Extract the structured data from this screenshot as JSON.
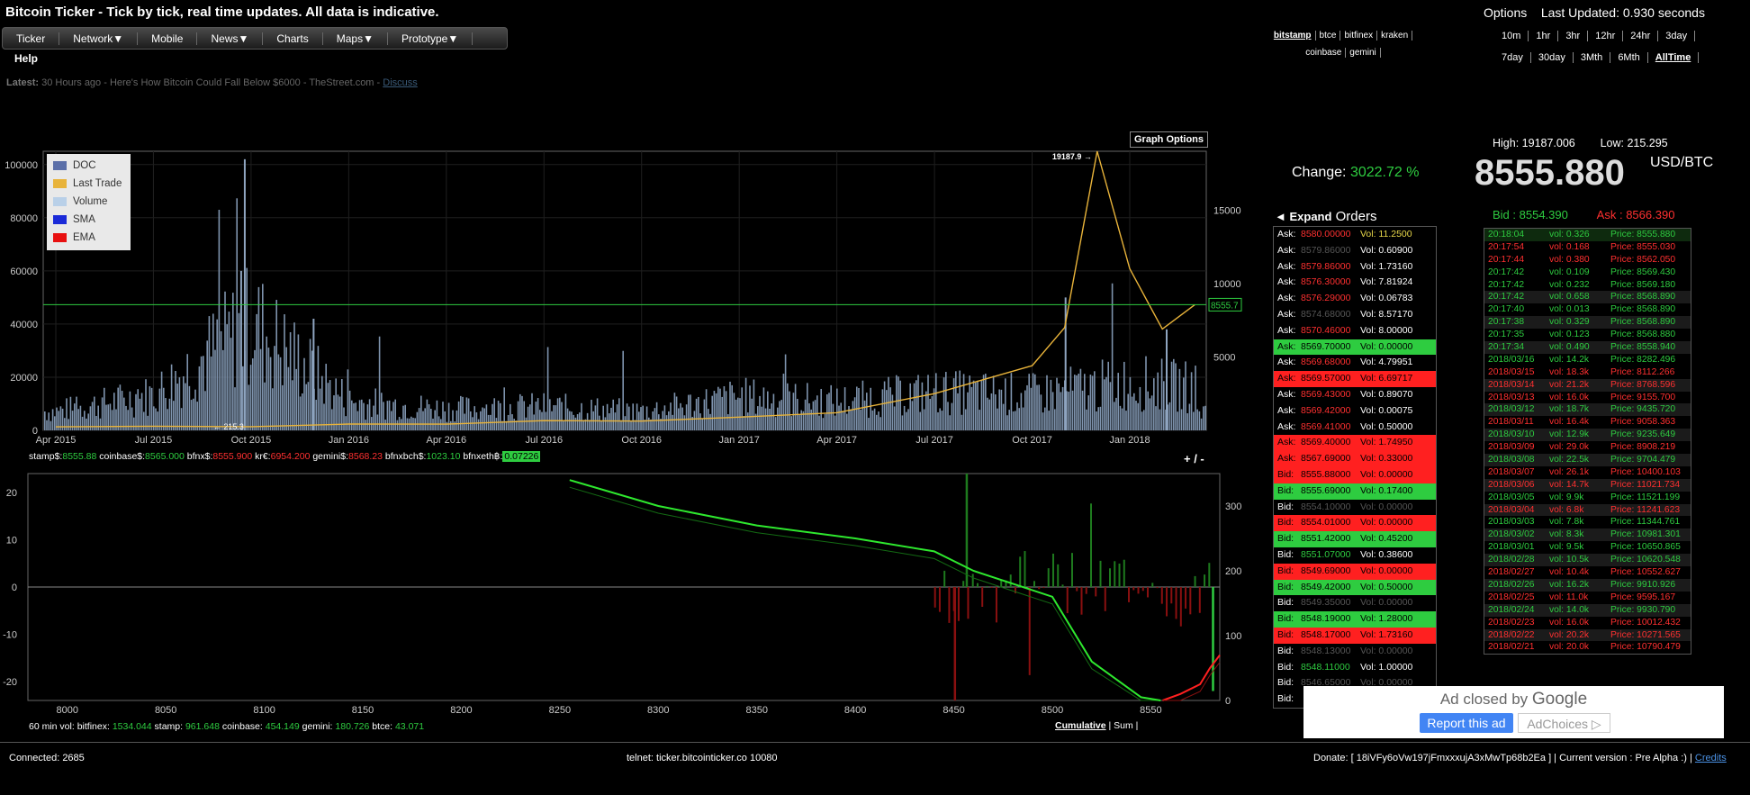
{
  "site": {
    "title": "Bitcoin Ticker - Tick by tick, real time updates. All data is indicative.",
    "nav": [
      "Ticker",
      "Network▼",
      "Mobile",
      "News▼",
      "Charts",
      "Maps▼",
      "Prototype▼"
    ],
    "help": "Help",
    "latest_label": "Latest:",
    "latest_text": "30 Hours ago - Here's How Bitcoin Could Fall Below $6000 - TheStreet.com -",
    "latest_link": "Discuss"
  },
  "exchanges": [
    "bitstamp",
    "btce",
    "bitfinex",
    "kraken",
    "coinbase",
    "gemini"
  ],
  "options": {
    "label": "Options",
    "updated_label": "Last Updated:",
    "updated_value": "0.930",
    "updated_unit": "seconds"
  },
  "ranges_row1": [
    "10m",
    "1hr",
    "3hr",
    "12hr",
    "24hr",
    "3day"
  ],
  "ranges_row2": [
    "7day",
    "30day",
    "3Mth",
    "6Mth",
    "AllTime"
  ],
  "graph_options": "Graph Options",
  "legend": [
    {
      "name": "DOC",
      "color": "#5b6fa8"
    },
    {
      "name": "Last Trade",
      "color": "#e8b33a"
    },
    {
      "name": "Volume",
      "color": "#b9d0e8"
    },
    {
      "name": "SMA",
      "color": "#1a2ad8"
    },
    {
      "name": "EMA",
      "color": "#e81010"
    }
  ],
  "chart_data": [
    {
      "type": "line",
      "x_ticks": [
        "Apr 2015",
        "Jul 2015",
        "Oct 2015",
        "Jan 2016",
        "Apr 2016",
        "Jul 2016",
        "Oct 2016",
        "Jan 2017",
        "Apr 2017",
        "Jul 2017",
        "Oct 2017",
        "Jan 2018"
      ],
      "y_left_ticks": [
        "0",
        "20000",
        "40000",
        "60000",
        "80000",
        "100000"
      ],
      "y_right_ticks": [
        "5000",
        "10000",
        "15000"
      ],
      "ylim_left": [
        0,
        105000
      ],
      "ylim_right": [
        0,
        19000
      ],
      "price_marks": {
        "high": "19187.9",
        "low": "215.3",
        "current": "8555.7"
      },
      "series": [
        {
          "name": "Last Trade",
          "x": [
            "Apr 2015",
            "Jul 2015",
            "Oct 2015",
            "Jan 2016",
            "Apr 2016",
            "Jul 2016",
            "Oct 2016",
            "Jan 2017",
            "Apr 2017",
            "Jul 2017",
            "Oct 2017",
            "Nov 2017",
            "Dec 2017",
            "Jan 2018",
            "Feb 2018",
            "Mar 2018"
          ],
          "values": [
            240,
            280,
            250,
            430,
            420,
            660,
            630,
            900,
            1200,
            2500,
            4400,
            7000,
            19000,
            11000,
            6900,
            8555
          ]
        },
        {
          "name": "Volume",
          "x": [
            "Apr 2015",
            "Jul 2015",
            "Oct 2015",
            "Jan 2016",
            "Apr 2016",
            "Jul 2016",
            "Oct 2016",
            "Jan 2017",
            "Apr 2017",
            "Jul 2017",
            "Oct 2017",
            "Jan 2018",
            "Mar 2018"
          ],
          "values": [
            8000,
            15000,
            45000,
            12000,
            9000,
            10000,
            8000,
            14000,
            12000,
            16000,
            15000,
            20000,
            18000
          ]
        }
      ],
      "grid": true,
      "legend_position": "top-left"
    },
    {
      "type": "area",
      "x_ticks": [
        "8000",
        "8050",
        "8100",
        "8150",
        "8200",
        "8250",
        "8300",
        "8350",
        "8400",
        "8450",
        "8500",
        "8550"
      ],
      "y_left_ticks": [
        "-20",
        "-10",
        "0",
        "10",
        "20"
      ],
      "y_right_ticks": [
        "0",
        "100",
        "200",
        "300"
      ],
      "xlim": [
        7980,
        8585
      ],
      "ylim_left": [
        -24,
        24
      ],
      "ylim_right": [
        0,
        350
      ],
      "series": [
        {
          "name": "Bid cumulative",
          "x": [
            8255,
            8300,
            8350,
            8400,
            8440,
            8460,
            8500,
            8520,
            8545,
            8555
          ],
          "values": [
            340,
            300,
            270,
            250,
            230,
            200,
            160,
            60,
            5,
            0
          ]
        },
        {
          "name": "Ask cumulative",
          "x": [
            8556,
            8565,
            8575,
            8580,
            8585
          ],
          "values": [
            0,
            10,
            25,
            50,
            70
          ]
        }
      ]
    }
  ],
  "mid_prices": [
    {
      "label": "stamp$:",
      "value": "8555.88",
      "cls": "g"
    },
    {
      "label": "coinbase$:",
      "value": "8565.000",
      "cls": "g"
    },
    {
      "label": "bfnx$:",
      "value": "8555.900",
      "cls": "r"
    },
    {
      "label": "kr€:",
      "value": "6954.200",
      "cls": "r"
    },
    {
      "label": "gemini$:",
      "value": "8568.23",
      "cls": "r"
    },
    {
      "label": "bfnxbch$:",
      "value": "1023.10",
      "cls": "g"
    },
    {
      "label": "bfnxeth฿:",
      "value": "0.07226",
      "cls": "box"
    }
  ],
  "plusminus": "+ / -",
  "vol60": {
    "label": "60 min vol:",
    "items": [
      {
        "label": "bitfinex:",
        "value": "1534.044"
      },
      {
        "label": "stamp:",
        "value": "961.648"
      },
      {
        "label": "coinbase:",
        "value": "454.149"
      },
      {
        "label": "gemini:",
        "value": "180.726"
      },
      {
        "label": "btce:",
        "value": "43.071"
      }
    ]
  },
  "cum_toggle": {
    "cumulative": "Cumulative",
    "sum": "Sum"
  },
  "footer": {
    "connected": "Connected:  2685",
    "telnet": "telnet: ticker.bitcointicker.co 10080",
    "donate": "Donate: [ 18iVFy6oVw197jFmxxxujA3xMwTp68b2Ea ] | Current version : Pre Alpha :) |",
    "credits": "Credits"
  },
  "stats": {
    "high_label": "High:",
    "high": "19187.006",
    "low_label": "Low:",
    "low": "215.295",
    "price": "8555.880",
    "unit": "USD/BTC",
    "change_label": "Change:",
    "change": "3022.72 %",
    "bid_label": "Bid  :",
    "bid": "8554.390",
    "ask_label": "Ask  :",
    "ask": "8566.390"
  },
  "orders_header": {
    "expand": "◄ Expand",
    "title": "Orders"
  },
  "orderbook": [
    {
      "side": "Ask:",
      "price": "8580.00000",
      "vol": "Vol: 11.2500",
      "pc": "#ff3030",
      "vc": "#e8d84a",
      "bg": ""
    },
    {
      "side": "Ask:",
      "price": "8579.86000",
      "vol": "Vol: 0.60900",
      "pc": "#555",
      "vc": "#fff",
      "bg": ""
    },
    {
      "side": "Ask:",
      "price": "8579.86000",
      "vol": "Vol: 1.73160",
      "pc": "#ff3030",
      "vc": "#fff",
      "bg": ""
    },
    {
      "side": "Ask:",
      "price": "8576.30000",
      "vol": "Vol: 7.81924",
      "pc": "#ff3030",
      "vc": "#fff",
      "bg": ""
    },
    {
      "side": "Ask:",
      "price": "8576.29000",
      "vol": "Vol: 0.06783",
      "pc": "#ff3030",
      "vc": "#fff",
      "bg": ""
    },
    {
      "side": "Ask:",
      "price": "8574.68000",
      "vol": "Vol: 8.57170",
      "pc": "#555",
      "vc": "#fff",
      "bg": ""
    },
    {
      "side": "Ask:",
      "price": "8570.46000",
      "vol": "Vol: 8.00000",
      "pc": "#ff3030",
      "vc": "#fff",
      "bg": ""
    },
    {
      "side": "Ask:",
      "price": "8569.70000",
      "vol": "Vol: 0.00000",
      "pc": "#000",
      "vc": "#000",
      "bg": "#2ecc40"
    },
    {
      "side": "Ask:",
      "price": "8569.68000",
      "vol": "Vol: 4.79951",
      "pc": "#ff3030",
      "vc": "#fff",
      "bg": ""
    },
    {
      "side": "Ask:",
      "price": "8569.57000",
      "vol": "Vol: 6.69717",
      "pc": "#000",
      "vc": "#000",
      "bg": "#ff2020"
    },
    {
      "side": "Ask:",
      "price": "8569.43000",
      "vol": "Vol: 0.89070",
      "pc": "#ff3030",
      "vc": "#fff",
      "bg": ""
    },
    {
      "side": "Ask:",
      "price": "8569.42000",
      "vol": "Vol: 0.00075",
      "pc": "#ff3030",
      "vc": "#fff",
      "bg": ""
    },
    {
      "side": "Ask:",
      "price": "8569.41000",
      "vol": "Vol: 0.50000",
      "pc": "#ff3030",
      "vc": "#fff",
      "bg": ""
    },
    {
      "side": "Ask:",
      "price": "8569.40000",
      "vol": "Vol: 1.74950",
      "pc": "#000",
      "vc": "#000",
      "bg": "#ff2020"
    },
    {
      "side": "Ask:",
      "price": "8567.69000",
      "vol": "Vol: 0.33000",
      "pc": "#000",
      "vc": "#000",
      "bg": "#ff2020"
    },
    {
      "side": "Bid:",
      "price": "8555.88000",
      "vol": "Vol: 0.00000",
      "pc": "#000",
      "vc": "#000",
      "bg": "#ff2020"
    },
    {
      "side": "Bid:",
      "price": "8555.69000",
      "vol": "Vol: 0.17400",
      "pc": "#000",
      "vc": "#000",
      "bg": "#2ecc40"
    },
    {
      "side": "Bid:",
      "price": "8554.10000",
      "vol": "Vol: 0.00000",
      "pc": "#555",
      "vc": "#555",
      "bg": ""
    },
    {
      "side": "Bid:",
      "price": "8554.01000",
      "vol": "Vol: 0.00000",
      "pc": "#000",
      "vc": "#000",
      "bg": "#ff2020"
    },
    {
      "side": "Bid:",
      "price": "8551.42000",
      "vol": "Vol: 0.45200",
      "pc": "#000",
      "vc": "#000",
      "bg": "#2ecc40"
    },
    {
      "side": "Bid:",
      "price": "8551.07000",
      "vol": "Vol: 0.38600",
      "pc": "#2ecc40",
      "vc": "#fff",
      "bg": ""
    },
    {
      "side": "Bid:",
      "price": "8549.69000",
      "vol": "Vol: 0.00000",
      "pc": "#000",
      "vc": "#000",
      "bg": "#ff2020"
    },
    {
      "side": "Bid:",
      "price": "8549.42000",
      "vol": "Vol: 0.50000",
      "pc": "#000",
      "vc": "#000",
      "bg": "#2ecc40"
    },
    {
      "side": "Bid:",
      "price": "8549.35000",
      "vol": "Vol: 0.00000",
      "pc": "#555",
      "vc": "#555",
      "bg": ""
    },
    {
      "side": "Bid:",
      "price": "8548.19000",
      "vol": "Vol: 1.28000",
      "pc": "#000",
      "vc": "#000",
      "bg": "#2ecc40"
    },
    {
      "side": "Bid:",
      "price": "8548.17000",
      "vol": "Vol: 1.73160",
      "pc": "#000",
      "vc": "#000",
      "bg": "#ff2020"
    },
    {
      "side": "Bid:",
      "price": "8548.13000",
      "vol": "Vol: 0.00000",
      "pc": "#555",
      "vc": "#555",
      "bg": ""
    },
    {
      "side": "Bid:",
      "price": "8548.11000",
      "vol": "Vol: 1.00000",
      "pc": "#2ecc40",
      "vc": "#fff",
      "bg": ""
    },
    {
      "side": "Bid:",
      "price": "8546.65000",
      "vol": "Vol: 0.00000",
      "pc": "#555",
      "vc": "#555",
      "bg": ""
    },
    {
      "side": "Bid:",
      "price": "",
      "vol": "",
      "pc": "#fff",
      "vc": "#fff",
      "bg": ""
    }
  ],
  "trades": [
    {
      "t": "20:18:04",
      "v": "vol: 0.326",
      "p": "Price: 8555.880",
      "c": "#2ecc40",
      "bg": "#0e2a0e"
    },
    {
      "t": "20:17:54",
      "v": "vol: 0.168",
      "p": "Price: 8555.030",
      "c": "#ff3030",
      "bg": ""
    },
    {
      "t": "20:17:44",
      "v": "vol: 0.380",
      "p": "Price: 8562.050",
      "c": "#ff3030",
      "bg": ""
    },
    {
      "t": "20:17:42",
      "v": "vol: 0.109",
      "p": "Price: 8569.430",
      "c": "#2ecc40",
      "bg": ""
    },
    {
      "t": "20:17:42",
      "v": "vol: 0.232",
      "p": "Price: 8569.180",
      "c": "#2ecc40",
      "bg": ""
    },
    {
      "t": "20:17:42",
      "v": "vol: 0.658",
      "p": "Price: 8568.890",
      "c": "#2ecc40",
      "bg": "#1b1b1b"
    },
    {
      "t": "20:17:40",
      "v": "vol: 0.013",
      "p": "Price: 8568.890",
      "c": "#2ecc40",
      "bg": ""
    },
    {
      "t": "20:17:38",
      "v": "vol: 0.329",
      "p": "Price: 8568.890",
      "c": "#2ecc40",
      "bg": "#1b1b1b"
    },
    {
      "t": "20:17:35",
      "v": "vol: 0.123",
      "p": "Price: 8568.880",
      "c": "#2ecc40",
      "bg": ""
    },
    {
      "t": "20:17:34",
      "v": "vol: 0.490",
      "p": "Price: 8558.940",
      "c": "#2ecc40",
      "bg": "#1b1b1b"
    },
    {
      "t": "2018/03/16",
      "v": "vol: 14.2k",
      "p": "Price: 8282.496",
      "c": "#2ecc40",
      "bg": ""
    },
    {
      "t": "2018/03/15",
      "v": "vol: 18.3k",
      "p": "Price: 8112.266",
      "c": "#ff3030",
      "bg": ""
    },
    {
      "t": "2018/03/14",
      "v": "vol: 21.2k",
      "p": "Price: 8768.596",
      "c": "#ff3030",
      "bg": "#1b1b1b"
    },
    {
      "t": "2018/03/13",
      "v": "vol: 16.0k",
      "p": "Price: 9155.700",
      "c": "#ff3030",
      "bg": ""
    },
    {
      "t": "2018/03/12",
      "v": "vol: 18.7k",
      "p": "Price: 9435.720",
      "c": "#2ecc40",
      "bg": "#1b1b1b"
    },
    {
      "t": "2018/03/11",
      "v": "vol: 16.4k",
      "p": "Price: 9058.363",
      "c": "#ff3030",
      "bg": ""
    },
    {
      "t": "2018/03/10",
      "v": "vol: 12.9k",
      "p": "Price: 9235.649",
      "c": "#2ecc40",
      "bg": "#1b1b1b"
    },
    {
      "t": "2018/03/09",
      "v": "vol: 29.0k",
      "p": "Price: 8908.219",
      "c": "#ff3030",
      "bg": ""
    },
    {
      "t": "2018/03/08",
      "v": "vol: 22.5k",
      "p": "Price: 9704.479",
      "c": "#2ecc40",
      "bg": "#1b1b1b"
    },
    {
      "t": "2018/03/07",
      "v": "vol: 26.1k",
      "p": "Price: 10400.103",
      "c": "#ff3030",
      "bg": ""
    },
    {
      "t": "2018/03/06",
      "v": "vol: 14.7k",
      "p": "Price: 11021.734",
      "c": "#ff3030",
      "bg": "#1b1b1b"
    },
    {
      "t": "2018/03/05",
      "v": "vol: 9.9k",
      "p": "Price: 11521.199",
      "c": "#2ecc40",
      "bg": ""
    },
    {
      "t": "2018/03/04",
      "v": "vol: 6.8k",
      "p": "Price: 11241.623",
      "c": "#ff3030",
      "bg": "#1b1b1b"
    },
    {
      "t": "2018/03/03",
      "v": "vol: 7.8k",
      "p": "Price: 11344.761",
      "c": "#2ecc40",
      "bg": ""
    },
    {
      "t": "2018/03/02",
      "v": "vol: 8.3k",
      "p": "Price: 10981.301",
      "c": "#2ecc40",
      "bg": "#1b1b1b"
    },
    {
      "t": "2018/03/01",
      "v": "vol: 9.5k",
      "p": "Price: 10650.865",
      "c": "#2ecc40",
      "bg": ""
    },
    {
      "t": "2018/02/28",
      "v": "vol: 10.5k",
      "p": "Price: 10620.548",
      "c": "#2ecc40",
      "bg": "#1b1b1b"
    },
    {
      "t": "2018/02/27",
      "v": "vol: 10.4k",
      "p": "Price: 10552.627",
      "c": "#ff3030",
      "bg": ""
    },
    {
      "t": "2018/02/26",
      "v": "vol: 16.2k",
      "p": "Price: 9910.926",
      "c": "#2ecc40",
      "bg": "#1b1b1b"
    },
    {
      "t": "2018/02/25",
      "v": "vol: 11.0k",
      "p": "Price: 9595.167",
      "c": "#ff3030",
      "bg": ""
    },
    {
      "t": "2018/02/24",
      "v": "vol: 14.0k",
      "p": "Price: 9930.790",
      "c": "#2ecc40",
      "bg": "#1b1b1b"
    },
    {
      "t": "2018/02/23",
      "v": "vol: 16.0k",
      "p": "Price: 10012.432",
      "c": "#ff3030",
      "bg": ""
    },
    {
      "t": "2018/02/22",
      "v": "vol: 20.2k",
      "p": "Price: 10271.565",
      "c": "#ff3030",
      "bg": "#1b1b1b"
    },
    {
      "t": "2018/02/21",
      "v": "vol: 20.0k",
      "p": "Price: 10790.479",
      "c": "#ff3030",
      "bg": ""
    }
  ],
  "ad": {
    "closed_by": "Ad closed by",
    "brand": "Google",
    "report": "Report this ad",
    "choices": "AdChoices ▷"
  }
}
